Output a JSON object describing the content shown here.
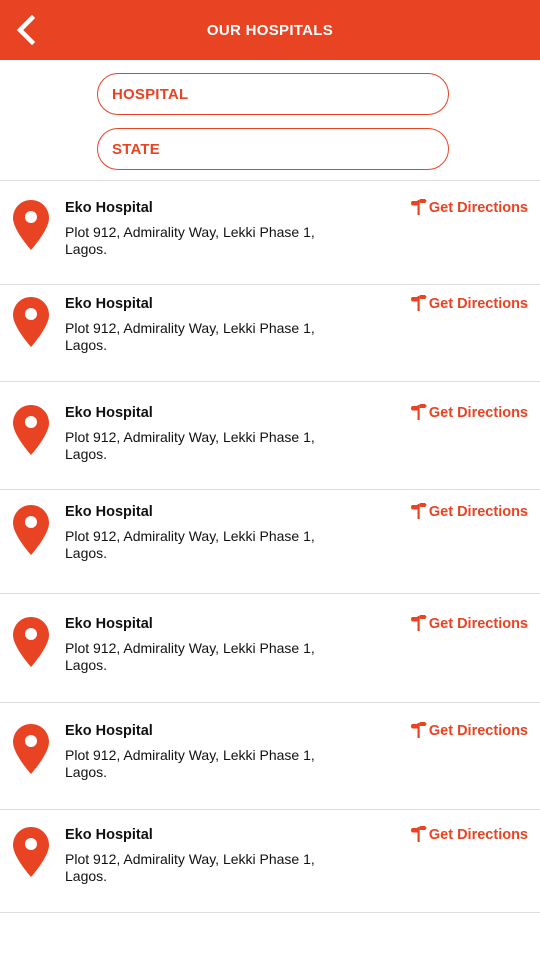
{
  "header": {
    "title": "OUR HOSPITALS",
    "back_icon": "chevron-left-icon",
    "color": "#e84424"
  },
  "filters": {
    "hospital_label": "HOSPITAL",
    "state_label": "STATE"
  },
  "hospitals": [
    {
      "name": "Eko Hospital",
      "address": "Plot 912, Admirality Way, Lekki Phase 1, Lagos.",
      "directions_label": "Get Directions"
    },
    {
      "name": "Eko Hospital",
      "address": "Plot 912, Admirality Way, Lekki Phase 1, Lagos.",
      "directions_label": "Get Directions"
    },
    {
      "name": "Eko Hospital",
      "address": "Plot 912, Admirality Way, Lekki Phase 1, Lagos.",
      "directions_label": "Get Directions"
    },
    {
      "name": "Eko Hospital",
      "address": "Plot 912, Admirality Way, Lekki Phase 1, Lagos.",
      "directions_label": "Get Directions"
    },
    {
      "name": "Eko Hospital",
      "address": "Plot 912, Admirality Way, Lekki Phase 1, Lagos.",
      "directions_label": "Get Directions"
    },
    {
      "name": "Eko Hospital",
      "address": "Plot 912, Admirality Way, Lekki Phase 1, Lagos.",
      "directions_label": "Get Directions"
    },
    {
      "name": "Eko Hospital",
      "address": "Plot 912, Admirality Way, Lekki Phase 1, Lagos.",
      "directions_label": "Get Directions"
    }
  ],
  "icons": {
    "pin": "map-pin-icon",
    "directions": "signpost-icon"
  }
}
